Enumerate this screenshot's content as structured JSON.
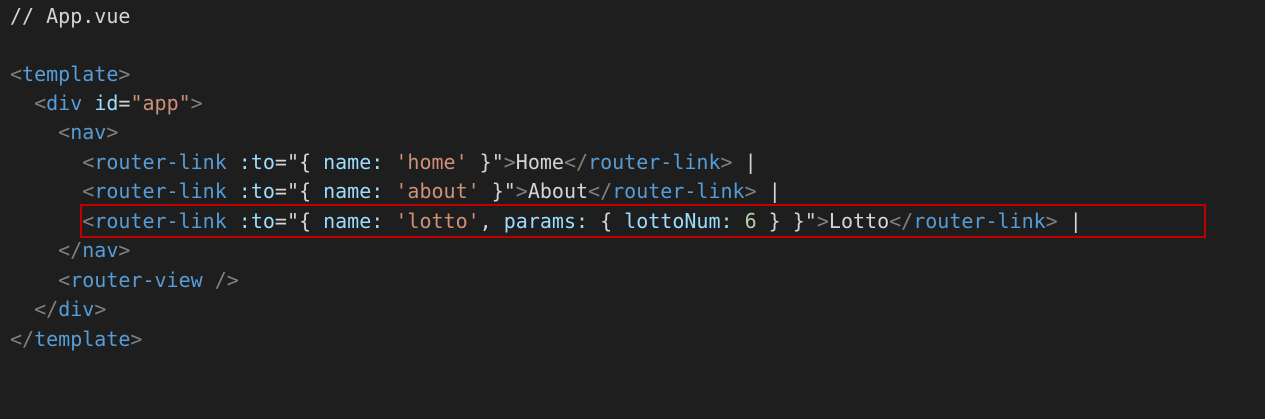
{
  "file": {
    "comment": "// App.vue"
  },
  "tags": {
    "template": "template",
    "div": "div",
    "nav": "nav",
    "router_link": "router-link",
    "router_view": "router-view"
  },
  "symbols": {
    "lt": "<",
    "gt": ">",
    "lt_slash": "</",
    "self_close": " />",
    "eq": "=",
    "quote": "\"",
    "pipe": "|"
  },
  "attrs": {
    "id": "id",
    "to": ":to"
  },
  "values": {
    "app_id": "\"app\""
  },
  "links": [
    {
      "to_open": "\"{ ",
      "name_key": "name:",
      "name_val": "'home'",
      "to_close": " }\"",
      "label": "Home"
    },
    {
      "to_open": "\"{ ",
      "name_key": "name:",
      "name_val": "'about'",
      "to_close": " }\"",
      "label": "About"
    },
    {
      "to_open": "\"{ ",
      "name_key": "name:",
      "name_val": "'lotto'",
      "sep": ", ",
      "params_key": "params:",
      "params_open": " { ",
      "param_key": "lottoNum:",
      "param_val": "6",
      "params_close": " } }\"",
      "label": "Lotto"
    }
  ],
  "colors": {
    "background": "#1e1e1e",
    "highlight_border": "#c00000"
  }
}
